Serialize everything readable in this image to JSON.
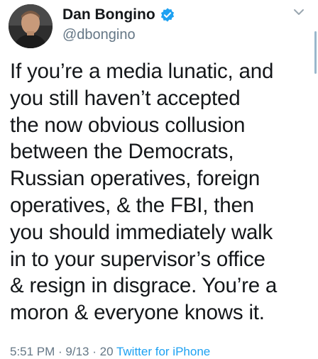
{
  "user": {
    "display_name": "Dan Bongino",
    "handle": "@dbongino",
    "verified": true
  },
  "tweet": {
    "lines": [
      "If you’re a media lunatic, and",
      "you still haven’t accepted",
      "the now obvious collusion",
      "between the Democrats,",
      "Russian operatives, foreign",
      "operatives, & the FBI, then",
      "you should immediately walk",
      "in to your supervisor’s office",
      "& resign in disgrace. You’re a",
      "moron & everyone knows it."
    ]
  },
  "meta": {
    "time_date": "5:51 PM · 9/13 · 20",
    "source": "Twitter for iPhone"
  },
  "icons": {
    "verified": "verified-badge-icon",
    "menu": "chevron-down-icon"
  },
  "colors": {
    "verified": "#1da1f2",
    "secondary_text": "#657786",
    "link": "#1da1f2"
  }
}
